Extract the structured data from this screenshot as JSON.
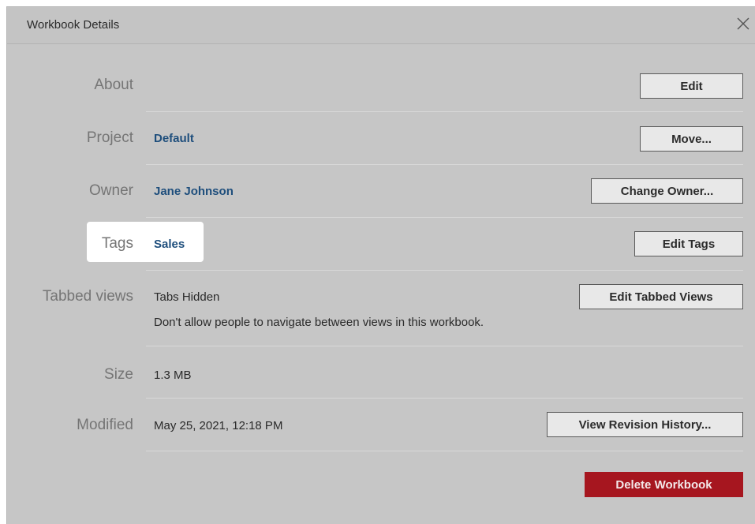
{
  "dialog": {
    "title": "Workbook Details",
    "close_icon": "close-icon"
  },
  "rows": {
    "about": {
      "label": "About",
      "button": "Edit"
    },
    "project": {
      "label": "Project",
      "value": "Default",
      "button": "Move..."
    },
    "owner": {
      "label": "Owner",
      "value": "Jane Johnson",
      "button": "Change Owner..."
    },
    "tags": {
      "label": "Tags",
      "value": "Sales",
      "button": "Edit Tags"
    },
    "tabbed_views": {
      "label": "Tabbed views",
      "value": "Tabs Hidden",
      "description": "Don't allow people to navigate between views in this workbook.",
      "button": "Edit Tabbed Views"
    },
    "size": {
      "label": "Size",
      "value": "1.3 MB"
    },
    "modified": {
      "label": "Modified",
      "value": "May 25, 2021, 12:18 PM",
      "button": "View Revision History..."
    }
  },
  "footer": {
    "delete_button": "Delete Workbook"
  },
  "colors": {
    "link": "#1e4e7c",
    "danger": "#a6161f",
    "dialog_background": "#c6c6c6",
    "highlight": "#ffffff"
  }
}
